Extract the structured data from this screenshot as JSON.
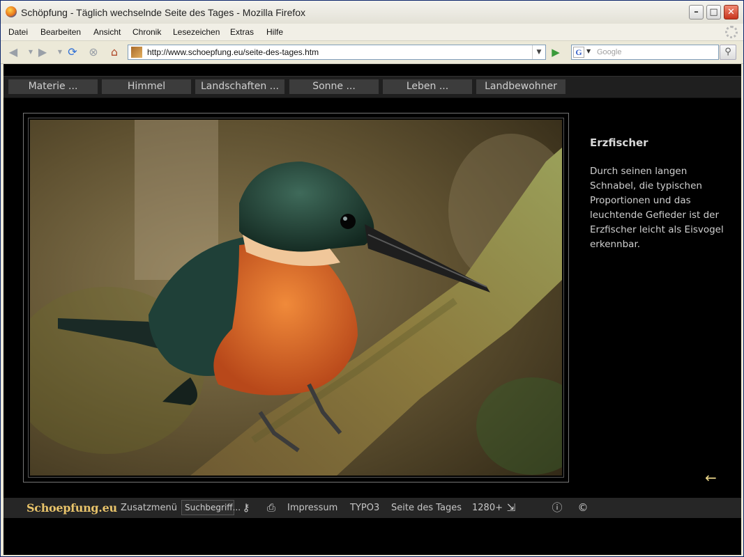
{
  "window": {
    "title": "Schöpfung - Täglich wechselnde Seite des Tages - Mozilla Firefox",
    "minimize_glyph": "–",
    "maximize_glyph": "□",
    "close_glyph": "✕"
  },
  "menu": [
    "Datei",
    "Bearbeiten",
    "Ansicht",
    "Chronik",
    "Lesezeichen",
    "Extras",
    "Hilfe"
  ],
  "toolbar": {
    "url": "http://www.schoepfung.eu/seite-des-tages.htm",
    "search_placeholder": "Google",
    "search_engine_glyph": "G"
  },
  "site_nav": [
    "Materie ...",
    "Himmel",
    "Landschaften ...",
    "Sonne ...",
    "Leben ...",
    "Landbewohner"
  ],
  "article": {
    "title": "Erzfischer",
    "text": "Durch seinen langen Schnabel, die typischen Proportionen und das leuchtende Gefieder ist der Erzfischer leicht als Eisvogel erkennbar."
  },
  "back_arrow_glyph": "←",
  "footer": {
    "logo": "Schoepfung.eu",
    "zusatzmenu": "Zusatzmenü",
    "search_value": "Suchbegriff...",
    "impressum": "Impressum",
    "typo3": "TYPO3",
    "seite_des_tages": "Seite des Tages",
    "resolution": "1280+"
  },
  "colors": {
    "page_bg": "#000000",
    "nav_tab_bg": "#3c3c3c",
    "logo_gold": "#e8c36a",
    "accent_arrow": "#e8d488"
  },
  "icons": [
    "back-icon",
    "forward-icon",
    "reload-icon",
    "stop-icon",
    "home-icon",
    "go-icon",
    "search-icon",
    "key-icon",
    "print-icon",
    "resize-icon",
    "info-icon",
    "copyright-icon"
  ]
}
